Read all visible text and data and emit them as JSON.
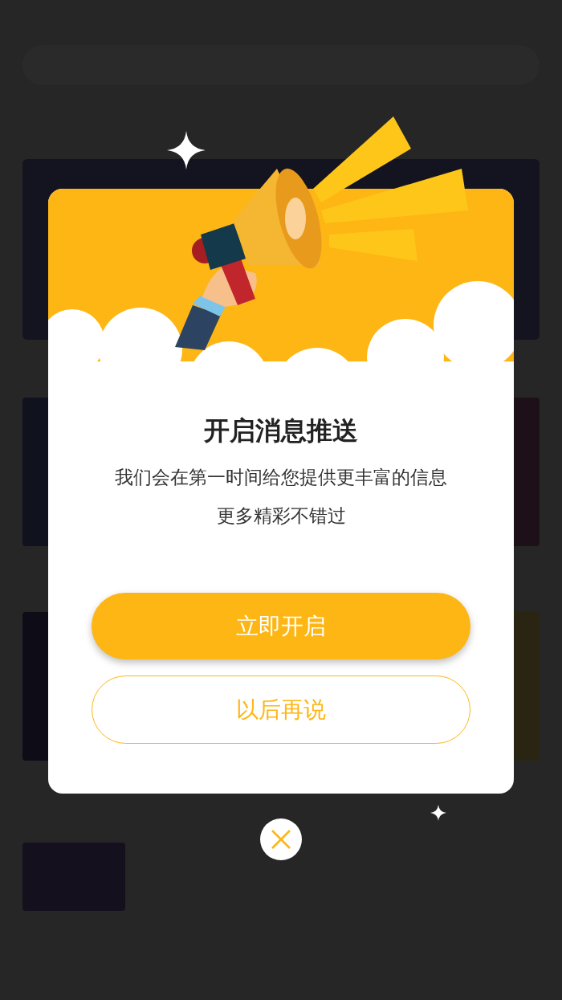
{
  "dialog": {
    "title": "开启消息推送",
    "message_lines": [
      "我们会在第一时间给您提供更丰富的信息",
      "更多精彩不错过"
    ],
    "buttons": [
      {
        "label": "立即开启",
        "kind": "primary"
      },
      {
        "label": "以后再说",
        "kind": "secondary"
      }
    ]
  }
}
